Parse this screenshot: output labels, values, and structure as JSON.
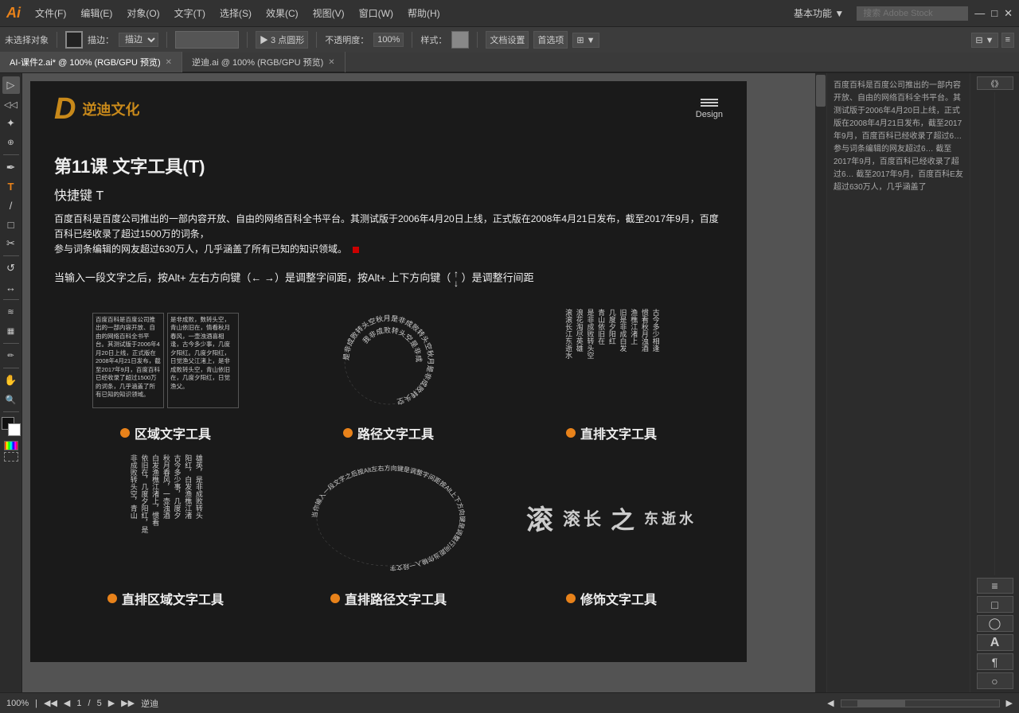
{
  "app": {
    "logo": "Ai",
    "logo_color": "#e8821a"
  },
  "menu": {
    "items": [
      "文件(F)",
      "编辑(E)",
      "对象(O)",
      "文字(T)",
      "选择(S)",
      "效果(C)",
      "视图(V)",
      "窗口(W)",
      "帮助(H)"
    ],
    "right": [
      "基本功能 ▼",
      "搜索 Adobe Stock"
    ]
  },
  "toolbar": {
    "no_selection": "未选择对象",
    "blend_mode": "描边：",
    "point_type": "▶ 3 点圆形",
    "opacity_label": "不透明度：",
    "opacity_value": "100%",
    "style_label": "样式：",
    "doc_settings": "文档设置",
    "preferences": "首选项"
  },
  "tabs": [
    {
      "label": "AI-课件2.ai* @ 100% (RGB/GPU 预览)",
      "active": true
    },
    {
      "label": "逆迪.ai @ 100% (RGB/GPU 预览)",
      "active": false
    }
  ],
  "document": {
    "header": {
      "logo_icon": "D",
      "logo_text": "逆迪文化",
      "menu_label": "Design"
    },
    "lesson": {
      "title": "第11课   文字工具(T)",
      "shortcut": "快捷键 T",
      "body_text": "百度百科是百度公司推出的一部内容开放、自由的网络百科全书平台。其测试版于2006年4月20日上线，正式版在2008年4月21日发布，截至2017年9月，百度百科已经收录了超过1500万的词条，\n参与词条编辑的网友超过630万人，几乎涵盖了所有已知的知识领域。",
      "tip_text": "当输入一段文字之后，按Alt+ 左右方向键（← →）是调整字间距，按Alt+ 上下方向键（ ↕ ）是调整行间距"
    },
    "tools_row1": [
      {
        "name": "区域文字工具",
        "type": "area"
      },
      {
        "name": "路径文字工具",
        "type": "path"
      },
      {
        "name": "直排文字工具",
        "type": "vertical"
      }
    ],
    "tools_row2": [
      {
        "name": "直排区域文字工具",
        "type": "vertical-area"
      },
      {
        "name": "直排路径文字工具",
        "type": "vertical-path"
      },
      {
        "name": "修饰文字工具",
        "type": "decorate"
      }
    ]
  },
  "right_panel": {
    "text": "百度百科是百度公司推出的一部内容开放、自由的网络百科全书平台。其测试版于2006年4月20日上线，正式版在2008年4月21日发布，截至2017年9月，百度百科已经收录了超过6…\n参与词条编辑的网友超过6…\n截至2017年9月，百度百科已经收录了超过6…\n截至2017年9月，百度百科E友超过630万人，几乎涵盖了"
  },
  "status_bar": {
    "zoom": "100%",
    "page": "1",
    "total_pages": "5",
    "artboard": "逆迪"
  },
  "left_tools": [
    {
      "icon": "▷",
      "name": "selection-tool"
    },
    {
      "icon": "◁",
      "name": "direct-selection-tool"
    },
    {
      "icon": "✦",
      "name": "magic-wand-tool"
    },
    {
      "icon": "⊕",
      "name": "lasso-tool"
    },
    {
      "icon": "✒",
      "name": "pen-tool"
    },
    {
      "icon": "T",
      "name": "type-tool"
    },
    {
      "icon": "/",
      "name": "line-tool"
    },
    {
      "icon": "□",
      "name": "rect-tool"
    },
    {
      "icon": "✂",
      "name": "scissors-tool"
    },
    {
      "icon": "↺",
      "name": "rotate-tool"
    },
    {
      "icon": "↔",
      "name": "reflect-tool"
    },
    {
      "icon": "⊞",
      "name": "scale-tool"
    },
    {
      "icon": "≋",
      "name": "warp-tool"
    },
    {
      "icon": "▣",
      "name": "graph-tool"
    },
    {
      "icon": "🖐",
      "name": "hand-tool"
    },
    {
      "icon": "🔍",
      "name": "zoom-tool"
    }
  ],
  "preview_texts": {
    "poem_text": "是非成败转头空，青山依旧在，几度夕阳红。白发渔樵江渚上，惯看秋月春风。一壶浊酒喜相逢，古今多少事，都付笑谈中。是非成败转头空，青山依旧在，几度夕阳红，日觉渔父。",
    "circle_poem": "是非成败转头空秋月是非成败转头空",
    "vertical_poem": "滚滚长江东逝水，浪花淘尽英雄，是非成败转头空，青山依旧在，几度夕阳红。",
    "calligraphy": "滚 滚长 之 东逝水"
  }
}
